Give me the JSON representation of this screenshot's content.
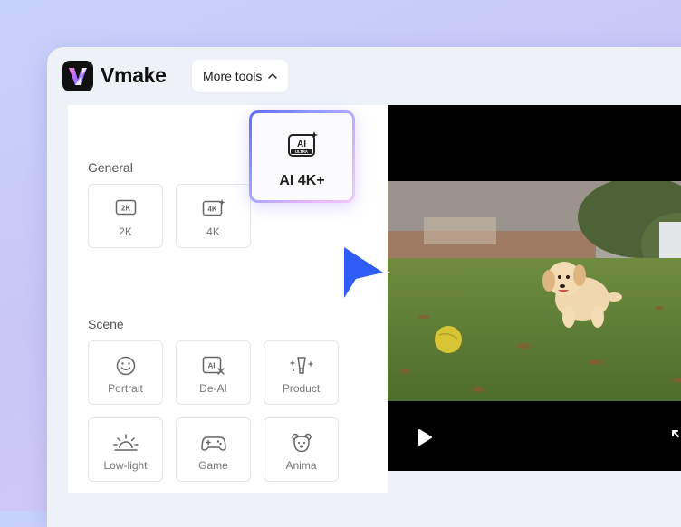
{
  "brand": {
    "name": "Vmake",
    "accent": "#6f5cff"
  },
  "topbar": {
    "more_tools_label": "More tools",
    "more_tools_icon": "chevron-up-icon"
  },
  "panel": {
    "general_label": "General",
    "scene_label": "Scene",
    "general_items": [
      {
        "label": "2K",
        "icon": "2k-icon"
      },
      {
        "label": "4K",
        "icon": "4k-sparkle-icon"
      },
      {
        "label": "AI 4K+",
        "icon": "ai-ultra-icon",
        "selected": true
      }
    ],
    "scene_items": [
      {
        "label": "Portrait",
        "icon": "smile-face-icon"
      },
      {
        "label": "De-AI",
        "icon": "de-ai-icon"
      },
      {
        "label": "Product",
        "icon": "product-light-icon"
      },
      {
        "label": "Low-light",
        "icon": "sunrise-icon"
      },
      {
        "label": "Game",
        "icon": "gamepad-icon"
      },
      {
        "label": "Anima",
        "icon": "bear-face-icon"
      }
    ]
  },
  "player": {
    "play_icon": "play-icon",
    "expand_icon": "expand-icon"
  }
}
